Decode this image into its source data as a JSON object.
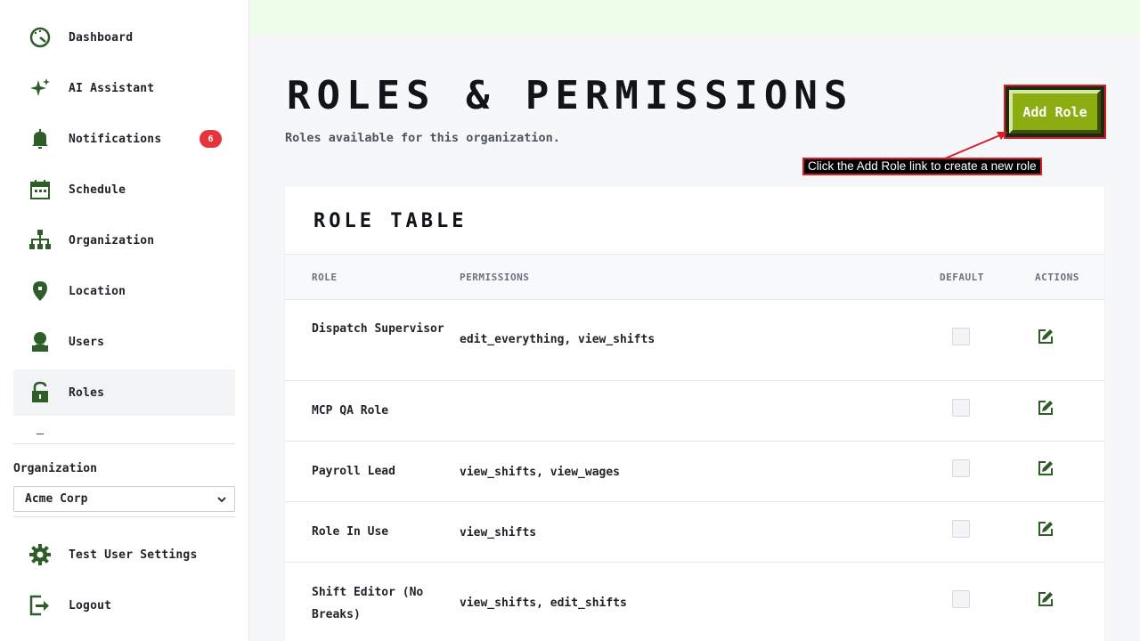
{
  "sidebar": {
    "items": [
      {
        "label": "Dashboard",
        "icon": "dashboard-icon"
      },
      {
        "label": "AI Assistant",
        "icon": "sparkle-icon"
      },
      {
        "label": "Notifications",
        "icon": "bell-icon",
        "badge": "6"
      },
      {
        "label": "Schedule",
        "icon": "calendar-icon"
      },
      {
        "label": "Organization",
        "icon": "org-chart-icon"
      },
      {
        "label": "Location",
        "icon": "location-pin-icon"
      },
      {
        "label": "Users",
        "icon": "user-icon"
      },
      {
        "label": "Roles",
        "icon": "unlock-icon",
        "active": true
      }
    ],
    "organization_label": "Organization",
    "organization_select": {
      "selected": "Acme Corp"
    },
    "footer_items": [
      {
        "label": "Test User Settings",
        "icon": "gear-icon"
      },
      {
        "label": "Logout",
        "icon": "logout-icon"
      }
    ]
  },
  "header": {
    "title": "Roles & Permissions",
    "subtitle": "Roles available for this organization.",
    "add_role_label": "Add Role"
  },
  "annotation": {
    "text": "Click the Add Role link to create a new role"
  },
  "table": {
    "title": "Role Table",
    "columns": [
      "Role",
      "Permissions",
      "Default",
      "Actions"
    ],
    "rows": [
      {
        "role": "Dispatch Supervisor",
        "permissions": "edit_everything, view_shifts",
        "default": false
      },
      {
        "role": "MCP QA Role",
        "permissions": "",
        "default": false
      },
      {
        "role": "Payroll Lead",
        "permissions": "view_shifts, view_wages",
        "default": false
      },
      {
        "role": "Role In Use",
        "permissions": "view_shifts",
        "default": false
      },
      {
        "role": "Shift Editor (No Breaks)",
        "permissions": "view_shifts, edit_shifts",
        "default": false
      }
    ]
  },
  "colors": {
    "accent_green": "#8cad12",
    "icon_green": "#2f5d2a",
    "badge_red": "#e5343d",
    "annotation_red": "#d51f2a",
    "topbar_green": "#eefde9"
  }
}
